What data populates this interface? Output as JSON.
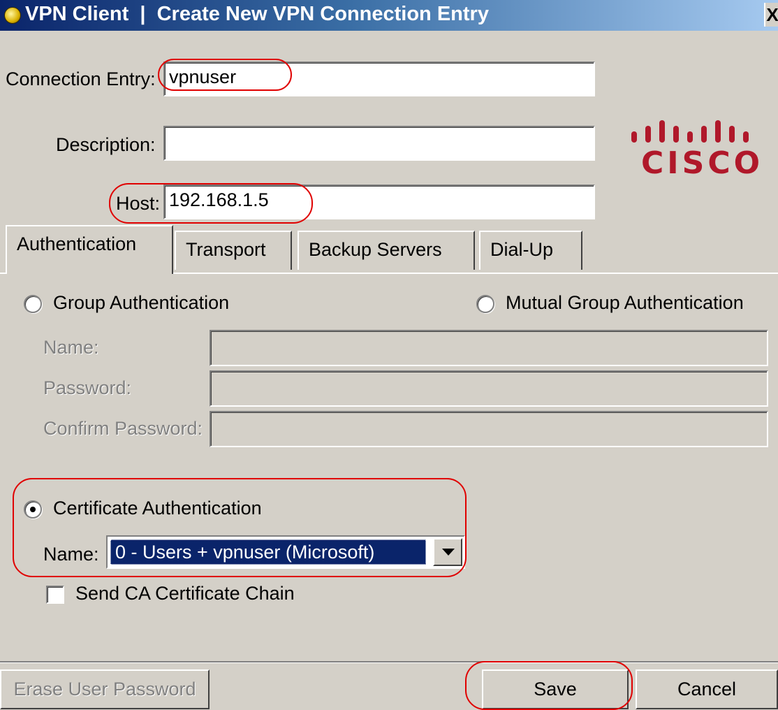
{
  "window": {
    "title": "VPN Client  |  Create New VPN Connection Entry",
    "close_glyph": "X"
  },
  "form": {
    "connection_entry_label": "Connection Entry:",
    "connection_entry_value": "vpnuser",
    "description_label": "Description:",
    "description_value": "",
    "host_label": "Host:",
    "host_value": "192.168.1.5"
  },
  "logo": {
    "text": "CISCO",
    "color": "#b0182a"
  },
  "tabs": [
    {
      "label": "Authentication",
      "active": true
    },
    {
      "label": "Transport",
      "active": false
    },
    {
      "label": "Backup Servers",
      "active": false
    },
    {
      "label": "Dial-Up",
      "active": false
    }
  ],
  "authentication": {
    "group_auth_label": "Group Authentication",
    "group_auth_selected": false,
    "mutual_group_auth_label": "Mutual Group Authentication",
    "mutual_group_auth_selected": false,
    "name_label": "Name:",
    "password_label": "Password:",
    "confirm_password_label": "Confirm Password:",
    "certificate_auth_label": "Certificate Authentication",
    "certificate_auth_selected": true,
    "cert_name_label": "Name:",
    "cert_name_value": "0 - Users + vpnuser (Microsoft)",
    "send_ca_chain_label": "Send CA Certificate Chain",
    "send_ca_chain_checked": false
  },
  "buttons": {
    "erase_password_label": "Erase User Password",
    "save_label": "Save",
    "cancel_label": "Cancel"
  },
  "colors": {
    "highlight": "#e00000",
    "titlebar": "#0a246a",
    "dialog_bg": "#d4d0c8"
  }
}
